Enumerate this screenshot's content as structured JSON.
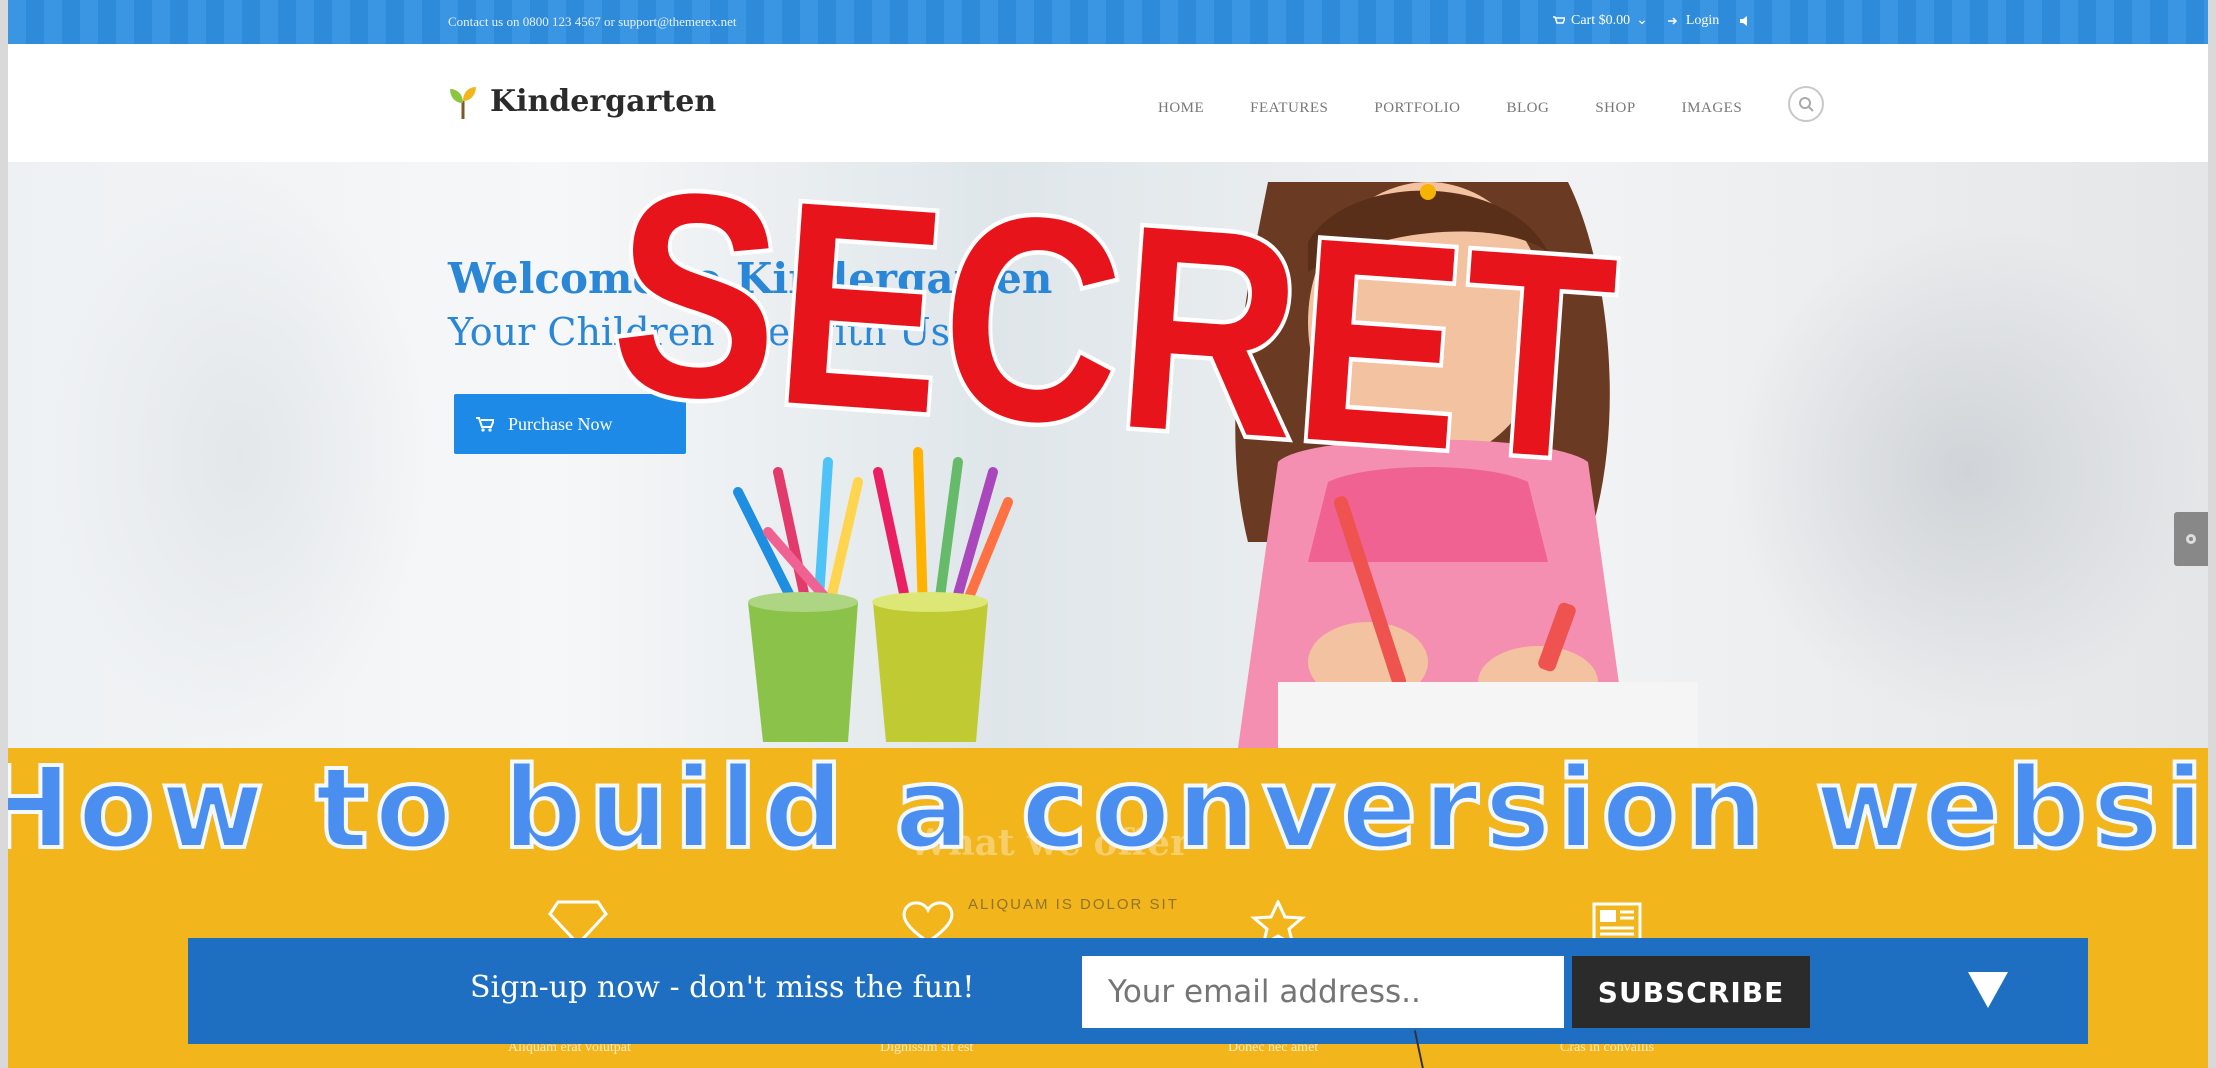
{
  "topbar": {
    "contact": "Contact us on 0800 123 4567 or support@themerex.net",
    "cart": "Cart $0.00",
    "login": "Login"
  },
  "header": {
    "logo_text": "Kindergarten",
    "nav": [
      "HOME",
      "FEATURES",
      "PORTFOLIO",
      "BLOG",
      "SHOP",
      "IMAGES"
    ]
  },
  "hero": {
    "title": "Welcome to Kindergarten",
    "subtitle": "Your Children are with Us!",
    "button": "Purchase Now"
  },
  "stamp": {
    "text": "SECRET",
    "color": "#e8141c"
  },
  "overlay": {
    "headline": "How to build a conversion websit"
  },
  "yellow": {
    "faded_heading": "What we offer",
    "faded_sub": "ALIQUAM IS DOLOR SIT",
    "captions": [
      "Aliquam erat volutpat",
      "Dignissim sit est",
      "Donec nec amet",
      "Cras in convallis"
    ],
    "icons": [
      "diamond-icon",
      "heart-icon",
      "star-icon",
      "newspaper-icon"
    ],
    "background": "#f2b61c"
  },
  "signup": {
    "text": "Sign-up now - don't miss the fun!",
    "email_placeholder": "Your email address..",
    "button": "SUBSCRIBE",
    "background": "#1e6fc2"
  },
  "colors": {
    "accent": "#2a86d6",
    "topbar": "#2f8fe0"
  }
}
